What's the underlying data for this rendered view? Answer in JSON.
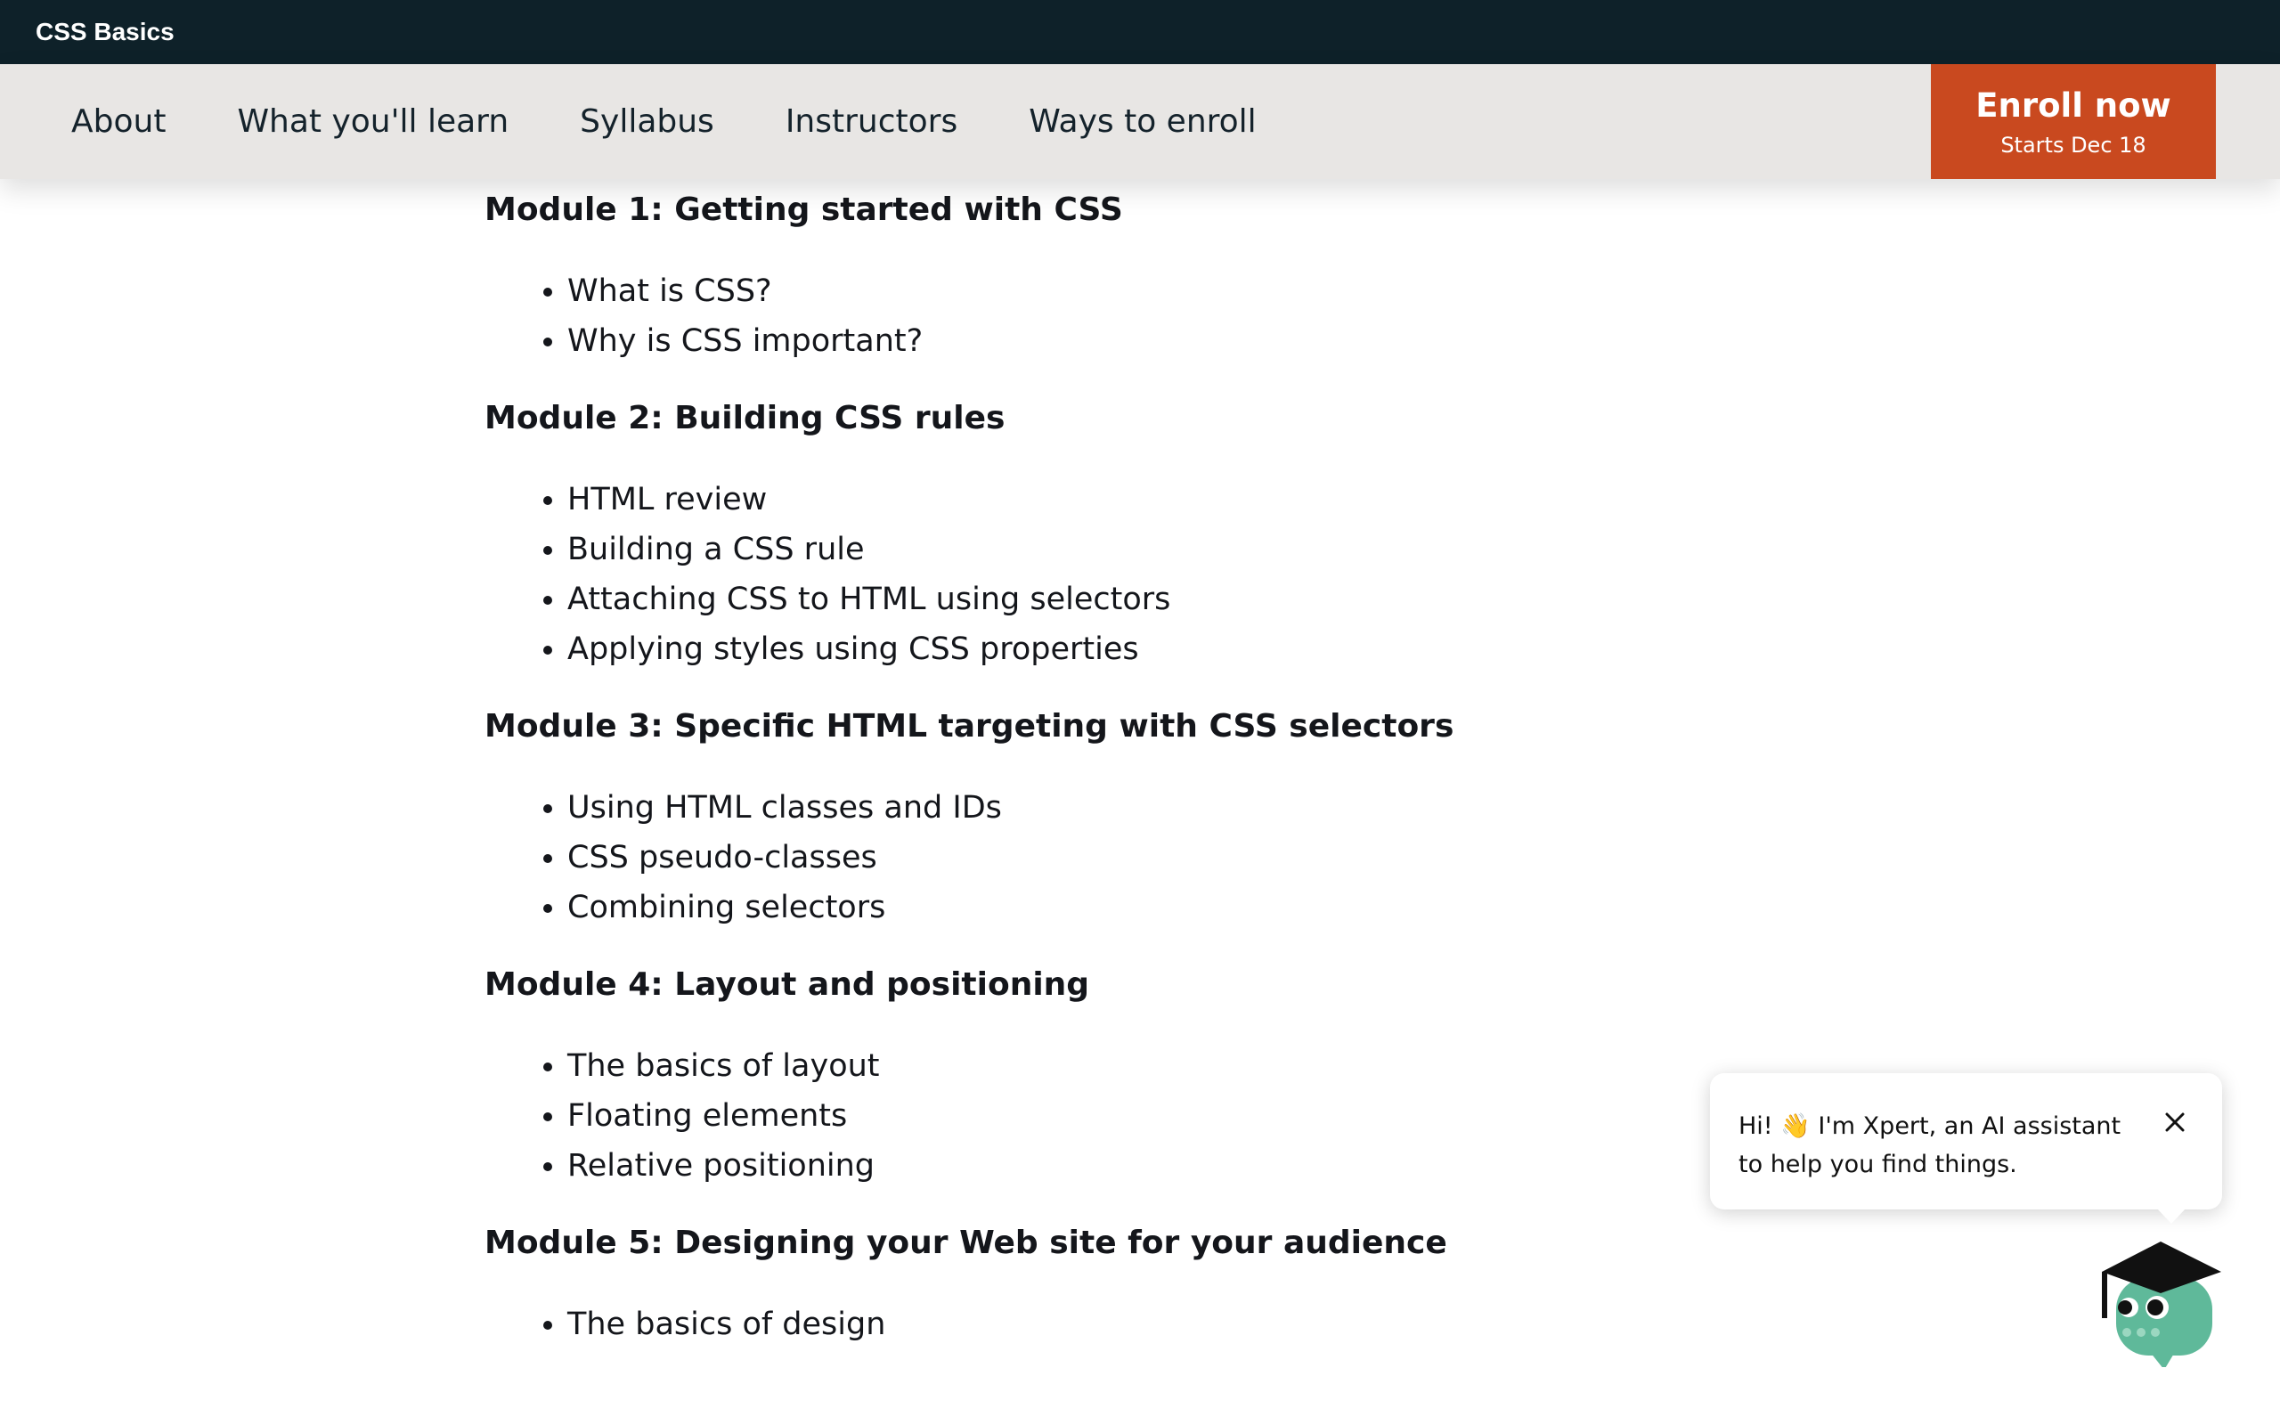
{
  "course": {
    "title": "CSS Basics"
  },
  "nav": {
    "items": [
      {
        "label": "About"
      },
      {
        "label": "What you'll learn"
      },
      {
        "label": "Syllabus"
      },
      {
        "label": "Instructors"
      },
      {
        "label": "Ways to enroll"
      }
    ],
    "enroll": {
      "label": "Enroll now",
      "subtitle": "Starts Dec 18"
    }
  },
  "modules": [
    {
      "title": "Module 1: Getting started with CSS",
      "items": [
        "What is CSS?",
        "Why is CSS important?"
      ]
    },
    {
      "title": "Module 2: Building CSS rules",
      "items": [
        "HTML review",
        "Building a CSS rule",
        "Attaching CSS to HTML using selectors",
        "Applying styles using CSS properties"
      ]
    },
    {
      "title": "Module 3: Specific HTML targeting with CSS selectors",
      "items": [
        "Using HTML classes and IDs",
        "CSS pseudo-classes",
        "Combining selectors"
      ]
    },
    {
      "title": "Module 4: Layout and positioning",
      "items": [
        "The basics of layout",
        "Floating elements",
        "Relative positioning"
      ]
    },
    {
      "title": "Module 5: Designing your Web site for your audience",
      "items": [
        "The basics of design"
      ]
    }
  ],
  "chat": {
    "message": "Hi! 👋 I'm Xpert, an AI assistant to help you find things.",
    "close_icon": "close-icon",
    "avatar_icon": "xpert-avatar-icon"
  },
  "colors": {
    "topbar": "#0e2129",
    "navbar": "#e8e6e4",
    "accent": "#c9491f",
    "avatar_body": "#5fb99a",
    "avatar_cap": "#111111"
  }
}
